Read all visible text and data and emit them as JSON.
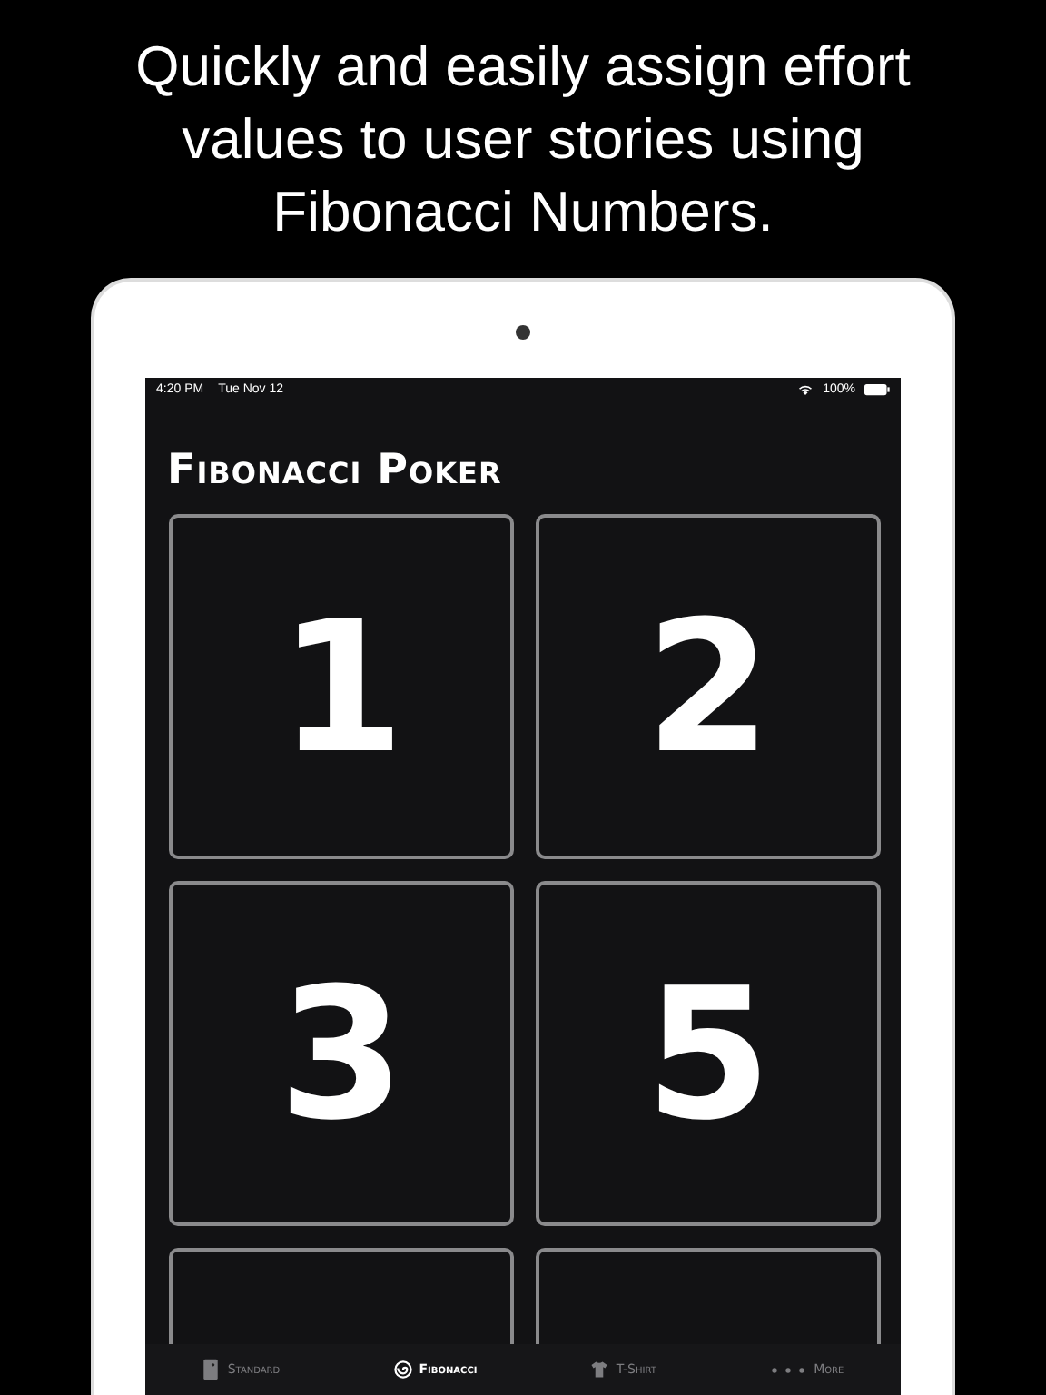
{
  "headline": "Quickly and easily assign effort values to user stories using Fibonacci Numbers.",
  "status_bar": {
    "time": "4:20 PM",
    "date": "Tue Nov 12",
    "battery": "100%"
  },
  "title": "Fibonacci Poker",
  "cards": [
    {
      "kind": "number",
      "value": "1"
    },
    {
      "kind": "number",
      "value": "2"
    },
    {
      "kind": "number",
      "value": "3"
    },
    {
      "kind": "number",
      "value": "5"
    },
    {
      "kind": "cut"
    },
    {
      "kind": "cut"
    }
  ],
  "tabs": [
    {
      "label": "Standard",
      "kind": "card",
      "selected": false
    },
    {
      "label": "Fibonacci",
      "kind": "spiral",
      "selected": true
    },
    {
      "label": "T-Shirt",
      "kind": "shirt",
      "selected": false
    },
    {
      "label": "More",
      "kind": "dots",
      "selected": false
    }
  ]
}
